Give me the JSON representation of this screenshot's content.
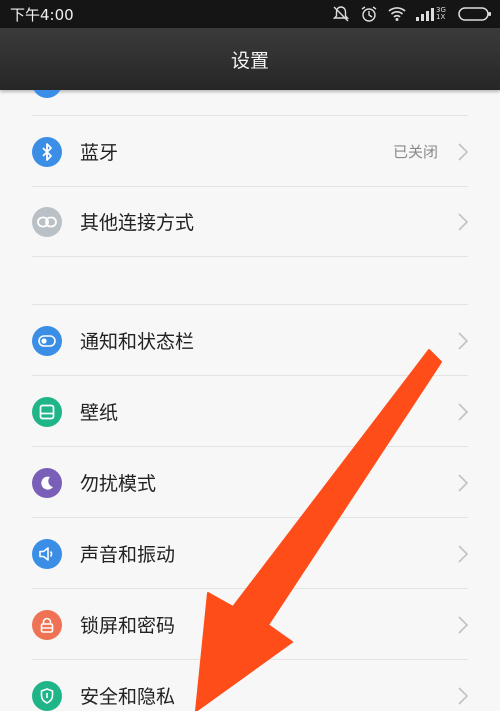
{
  "status_bar": {
    "time": "下午4:00",
    "network": "3G 1X"
  },
  "title_bar": {
    "title": "设置"
  },
  "settings": {
    "items": [
      {
        "label": "蓝牙",
        "value": "已关闭",
        "icon": "bluetooth-icon",
        "color": "#3a8ee6"
      },
      {
        "label": "其他连接方式",
        "icon": "link-icon",
        "color": "#b9c0c6"
      },
      {
        "label": "通知和状态栏",
        "icon": "notification-toggle-icon",
        "color": "#3a8ee6"
      },
      {
        "label": "壁纸",
        "icon": "wallpaper-icon",
        "color": "#1fb589"
      },
      {
        "label": "勿扰模式",
        "icon": "moon-icon",
        "color": "#7a5fb8"
      },
      {
        "label": "声音和振动",
        "icon": "speaker-icon",
        "color": "#3a8ee6"
      },
      {
        "label": "锁屏和密码",
        "icon": "lock-icon",
        "color": "#ee7253"
      },
      {
        "label": "安全和隐私",
        "icon": "shield-icon",
        "color": "#1fb589"
      }
    ]
  },
  "annotation": {
    "arrow_color": "#ff4d1a"
  }
}
